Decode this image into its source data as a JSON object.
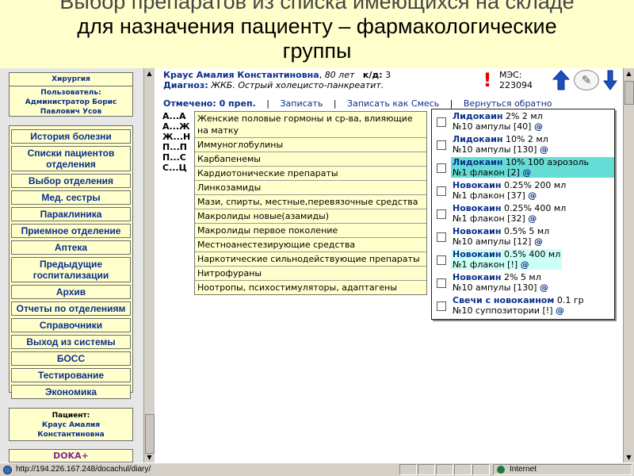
{
  "slide": {
    "title_line1": "Выбор препаратов из списка имеющихся на складе",
    "title_line2": "для назначения пациенту – фармакологические",
    "title_line3": "группы"
  },
  "sidebar": {
    "department": "Хирургия",
    "user_label": "Пользователь:",
    "user_name": "Администратор Борис Павлович Усов",
    "menu": [
      "История болезни",
      "Списки пациентов отделения",
      "Выбор отделения",
      "Мед. сестры",
      "Параклиника",
      "Приемное отделение",
      "Аптека",
      "Предыдущие госпитализации",
      "Архив",
      "Отчеты по отделениям",
      "Справочники",
      "Выход из системы",
      "БОСС",
      "Тестирование",
      "Экономика"
    ],
    "patient_label": "Пациент:",
    "patient_name": "Краус Амалия Константиновна",
    "logo_text": "DOKA+"
  },
  "header": {
    "patient_name": "Краус Амалия Константиновна",
    "age": "80 лет",
    "case_label": "к/д:",
    "case_value": "3",
    "diagnosis_label": "Диагноз:",
    "diagnosis": "ЖКБ. Острый холецисто-панкреатит.",
    "mes_label": "МЭС:",
    "mes_value": "223094"
  },
  "actions": {
    "selected": "Отмечено: 0 преп.",
    "save": "Записать",
    "save_mix": "Записать как Смесь",
    "back": "Вернуться обратно",
    "sep": "|"
  },
  "letters": [
    "А...А",
    "А...Ж",
    "Ж...Н",
    "П...П",
    "П...С",
    "С...Ц"
  ],
  "groups": [
    "Женские половые гормоны и ср-ва, влияющие на матку",
    "Иммуноглобулины",
    "Карбапенемы",
    "Кардиотонические препараты",
    "Линкозамиды",
    "Мази, спирты, местные,перевязочные средства",
    "Макролиды новые(азамиды)",
    "Макролиды первое поколение",
    "Местноанестезирующие средства",
    "Наркотические сильнодействующие препараты",
    "Нитрофураны",
    "Ноотропы, психостимуляторы, адаптагены"
  ],
  "drugs": [
    {
      "name": "Лидокаин",
      "dose": "2% 2 мл",
      "pack": "№10 ампулы [40]",
      "at": "@",
      "highlight": "none"
    },
    {
      "name": "Лидокаин",
      "dose": "10% 2 мл",
      "pack": "№10 ампулы [130]",
      "at": "@",
      "highlight": "none"
    },
    {
      "name": "Лидокаин",
      "dose": "10% 100 аэрозоль",
      "pack": "№1 флакон [2]",
      "at": "@",
      "highlight": "strong"
    },
    {
      "name": "Новокаин",
      "dose": "0.25% 200 мл",
      "pack": "№1 флакон [37]",
      "at": "@",
      "highlight": "none"
    },
    {
      "name": "Новокаин",
      "dose": "0.25% 400 мл",
      "pack": "№1 флакон [32]",
      "at": "@",
      "highlight": "none"
    },
    {
      "name": "Новокаин",
      "dose": "0.5% 5 мл",
      "pack": "№10 ампулы [12]",
      "at": "@",
      "highlight": "none"
    },
    {
      "name": "Новокаин",
      "dose": "0.5% 400 мл",
      "pack": "№1 флакон [!]",
      "at": "@",
      "highlight": "light"
    },
    {
      "name": "Новокаин",
      "dose": "2% 5 мл",
      "pack": "№10 ампулы [130]",
      "at": "@",
      "highlight": "none"
    },
    {
      "name": "Свечи с новокаином",
      "dose": "0.1 гр",
      "pack": "№10 суппозитории [!]",
      "at": "@",
      "highlight": "none"
    }
  ],
  "status": {
    "url": "http://194.226.167.248/docachul/diary/",
    "zone": "Internet"
  }
}
